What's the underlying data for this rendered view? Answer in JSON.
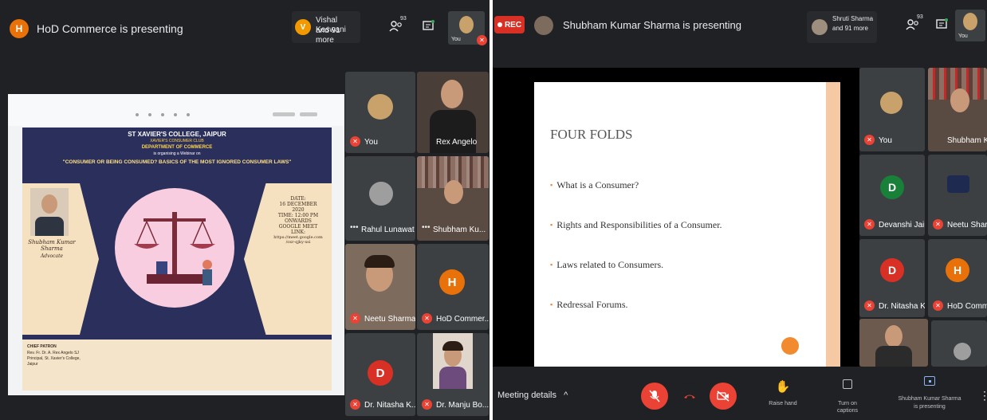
{
  "left": {
    "presenter_initial": "H",
    "presenting_text": "HoD Commerce is presenting",
    "others_initial": "V",
    "others_line1": "Vishal Keswani",
    "others_line2": "and 91 more",
    "participant_count": "93",
    "you_label": "You",
    "tiles": [
      {
        "name": "You"
      },
      {
        "name": "Rex Angelo"
      },
      {
        "name": "Rahul Lunawat"
      },
      {
        "name": "Shubham Ku..."
      },
      {
        "name": "Neetu Sharma"
      },
      {
        "name": "HoD Commer...",
        "initial": "H"
      },
      {
        "name": "Dr. Nitasha K...",
        "initial": "D"
      },
      {
        "name": "Dr. Manju Bo..."
      }
    ],
    "poster": {
      "college": "ST XAVIER'S COLLEGE, JAIPUR",
      "club": "XAVIER'S CONSUMER CLUB",
      "dept": "DEPARTMENT OF COMMERCE",
      "organising": "is organising a Webinar on",
      "title": "\"CONSUMER OR BEING CONSUMED? BASICS OF THE MOST IGNORED CONSUMER LAWS\"",
      "speaker": "Shubham Kumar Sharma",
      "speaker_role": "Advocate",
      "date_lines": [
        "DATE:",
        "16 DECEMBER",
        "2020",
        "TIME: 12:00 PM",
        "ONWARDS",
        "GOOGLE MEET",
        "LINK:",
        "https://meet.google.com",
        "/oxr-qjky-xsi"
      ],
      "patron_label": "CHIEF PATRON",
      "patron_lines": [
        "Rev. Fr. Dr. A. Rex Angelo SJ",
        "Principal, St. Xavier's College,",
        "Jaipur"
      ]
    }
  },
  "right": {
    "rec_label": "REC",
    "presenting_text": "Shubham Kumar Sharma is presenting",
    "others_line1": "Shruti Sharma",
    "others_line2": "and 91 more",
    "participant_count": "93",
    "you_label": "You",
    "slide": {
      "title": "FOUR FOLDS",
      "bullets": [
        "What is a Consumer?",
        "Rights and Responsibilities of a Consumer.",
        "Laws related to Consumers.",
        "Redressal Forums."
      ]
    },
    "tiles": [
      {
        "name": "You"
      },
      {
        "name": "Shubham Ku..."
      },
      {
        "name": "Devanshi Jain",
        "initial": "D"
      },
      {
        "name": "Neetu Sharma"
      },
      {
        "name": "Dr. Nitasha K...",
        "initial": "D"
      },
      {
        "name": "HoD Commer...",
        "initial": "H"
      }
    ],
    "bottom": {
      "meeting_details": "Meeting details",
      "raise_hand": "Raise hand",
      "captions": "Turn on captions",
      "presenting_line1": "Shubham Kumar Sharma",
      "presenting_line2": "is presenting"
    }
  },
  "colors": {
    "meet_dark": "#202124",
    "tile": "#3c4043",
    "red": "#ea4335",
    "orange": "#e8710a"
  }
}
